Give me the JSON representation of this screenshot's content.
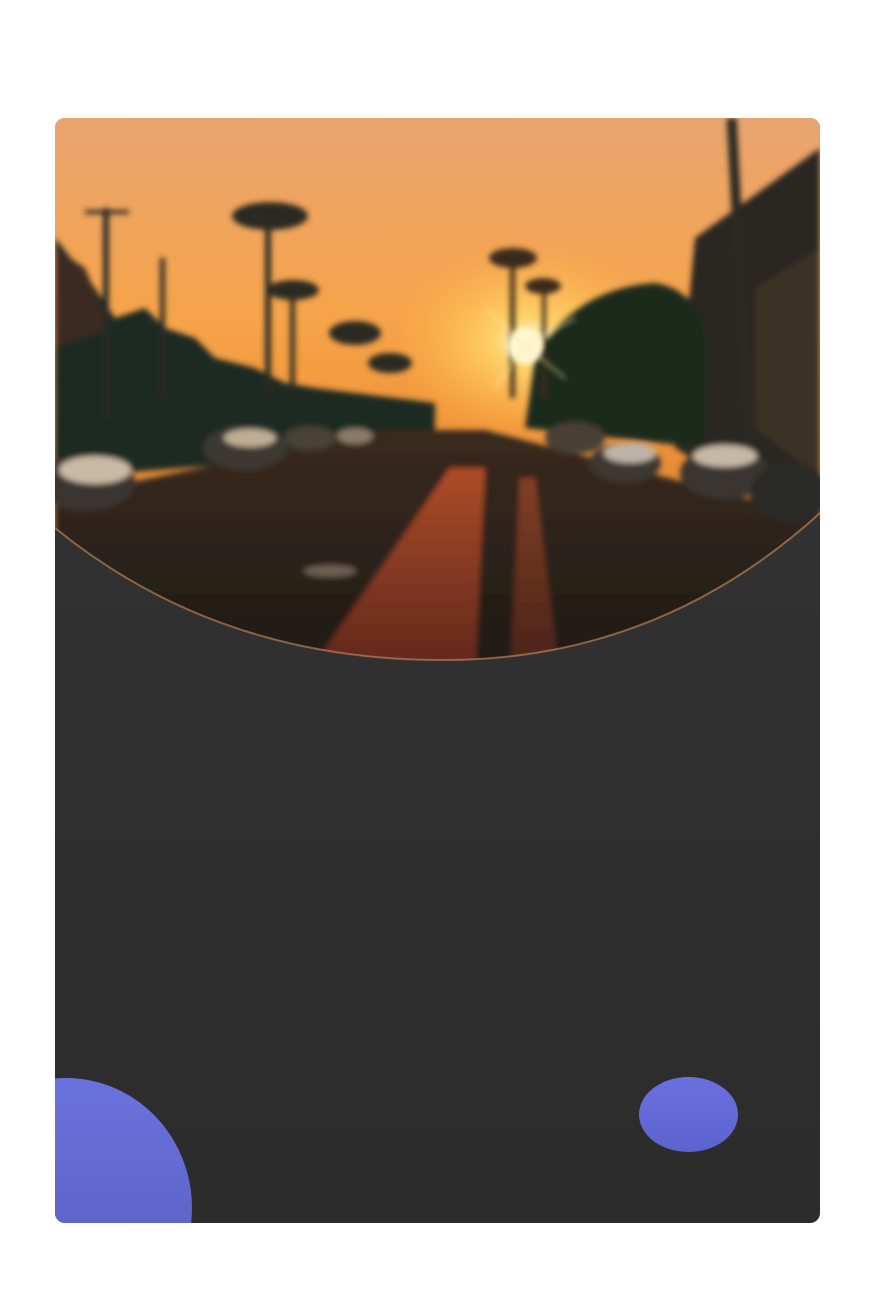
{
  "card": {
    "background": "#2f2f2f",
    "accent": "#6a72dd"
  },
  "hero_image": {
    "description_icon": "sunset-street-photo",
    "sky_colors": [
      "#f6a84a",
      "#e88c3a"
    ]
  },
  "decor": {
    "left_shape": "blob",
    "right_shape": "blob"
  }
}
